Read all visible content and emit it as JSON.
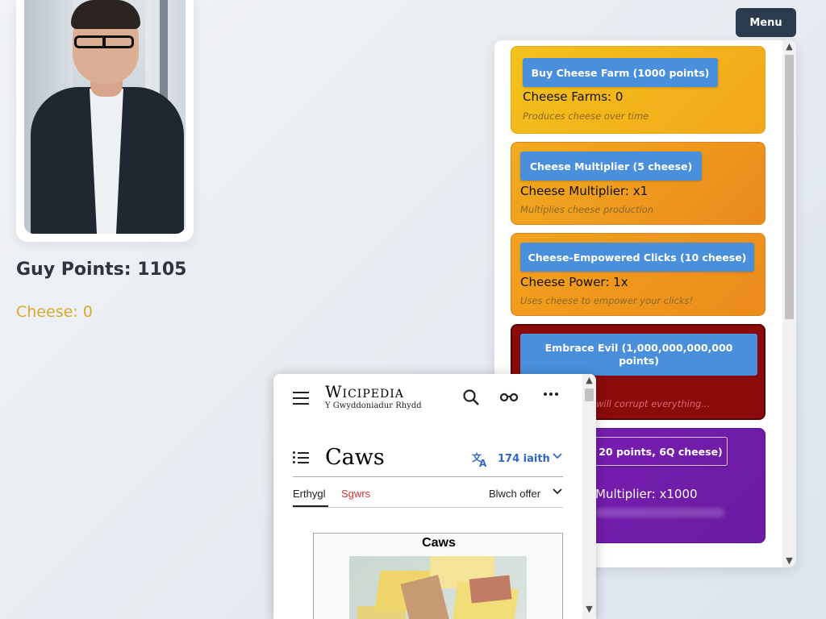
{
  "game": {
    "points_label": "Guy Points: 1105",
    "cheese_label": "Cheese: 0",
    "menu_label": "Menu"
  },
  "shop": {
    "items": [
      {
        "button": "Buy Cheese Farm (1000 points)",
        "stat": "Cheese Farms: 0",
        "description": "Produces cheese over time"
      },
      {
        "button": "Cheese Multiplier (5 cheese)",
        "stat": "Cheese Multiplier: x1",
        "description": "Multiplies cheese production"
      },
      {
        "button": "Cheese-Empowered Clicks (10 cheese)",
        "stat": "Cheese Power: 1x",
        "description": "Uses cheese to empower your clicks!"
      },
      {
        "button": "Embrace Evil (1,000,000,000,000 points)",
        "description": "will corrupt everything..."
      },
      {
        "button": "20 points, 6Q cheese)",
        "stat": "Multiplier: x1000"
      }
    ]
  },
  "wiki": {
    "wordmark": "Wicipedia",
    "tagline": "Y Gwyddoniadur Rhydd",
    "article_title": "Caws",
    "language_count": "174 iaith",
    "tab_article": "Erthygl",
    "tab_talk": "Sgwrs",
    "tools": "Blwch offer",
    "infobox_title": "Caws"
  },
  "colors": {
    "menu_bg": "#2c3a4d",
    "upgrade_button": "#4a8fdc",
    "cheese_text": "#d9a92b",
    "evil_card": "#8b0a0a",
    "purple_card": "#7b1eb2",
    "wiki_link": "#3366cc",
    "wiki_redlink": "#d73333"
  },
  "icons": [
    "hamburger-icon",
    "search-icon",
    "reading-glasses-icon",
    "more-icon",
    "toc-icon",
    "translate-icon",
    "chevron-down-icon"
  ]
}
